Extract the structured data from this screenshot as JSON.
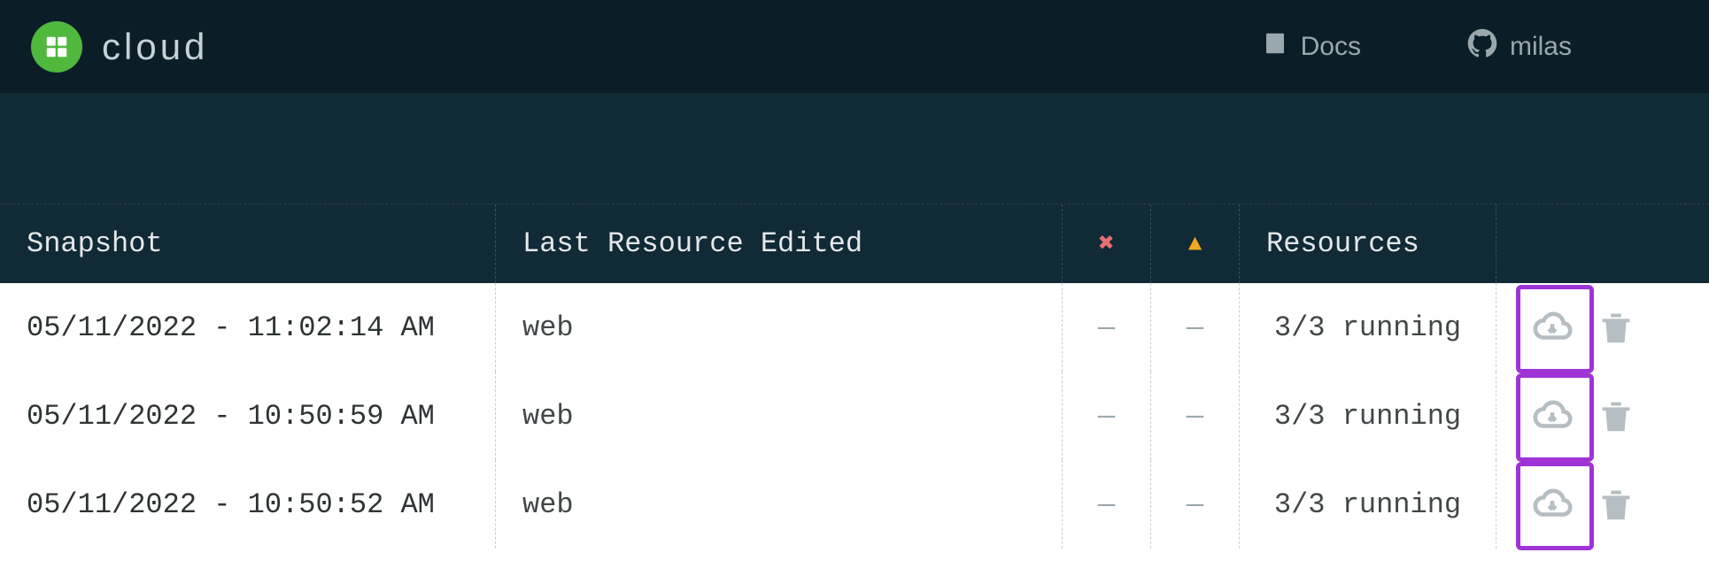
{
  "header": {
    "brand": "cloud",
    "links": {
      "docs": "Docs",
      "user": "milas"
    }
  },
  "table": {
    "columns": {
      "snapshot": "Snapshot",
      "last_resource_edited": "Last Resource Edited",
      "errors_icon": "error-icon",
      "warnings_icon": "warning-icon",
      "resources": "Resources"
    },
    "rows": [
      {
        "snapshot": "05/11/2022 - 11:02:14 AM",
        "last_resource_edited": "web",
        "errors": "—",
        "warnings": "—",
        "resources": "3/3 running"
      },
      {
        "snapshot": "05/11/2022 - 10:50:59 AM",
        "last_resource_edited": "web",
        "errors": "—",
        "warnings": "—",
        "resources": "3/3 running"
      },
      {
        "snapshot": "05/11/2022 - 10:50:52 AM",
        "last_resource_edited": "web",
        "errors": "—",
        "warnings": "—",
        "resources": "3/3 running"
      }
    ]
  },
  "colors": {
    "bg_dark": "#0b1d26",
    "bg_subheader": "#102a36",
    "accent_green": "#4fb83d",
    "highlight_purple": "#a033d6",
    "error_red": "#e76f6f",
    "warning_orange": "#f5a623"
  }
}
